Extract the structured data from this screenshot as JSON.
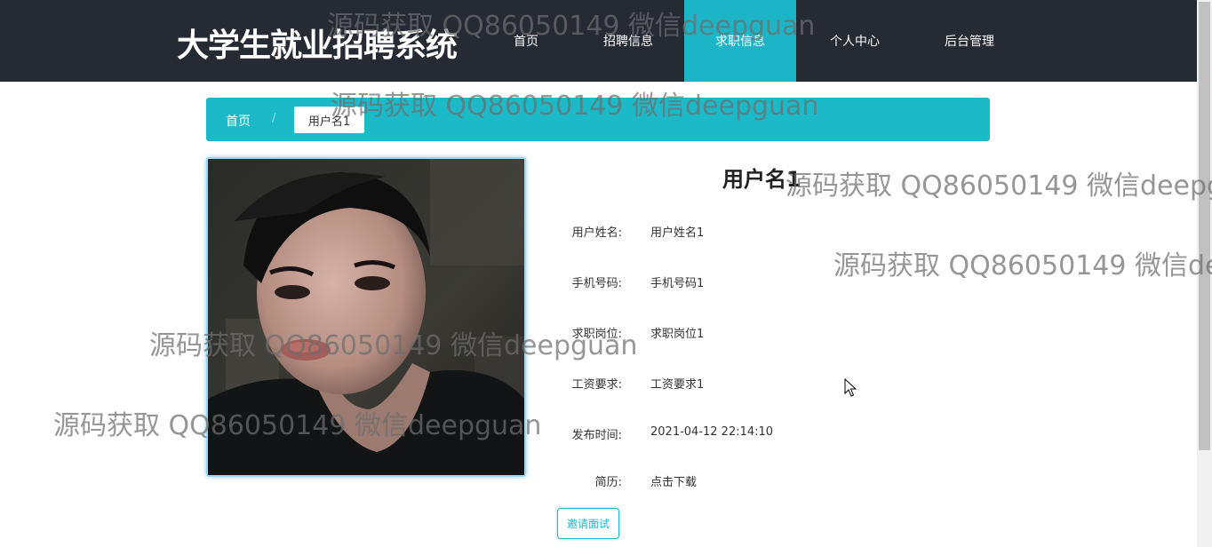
{
  "header": {
    "site_title": "大学生就业招聘系统",
    "nav": [
      "首页",
      "招聘信息",
      "求职信息",
      "个人中心",
      "后台管理"
    ],
    "active_nav": "求职信息"
  },
  "breadcrumb": {
    "home": "首页",
    "separator": "/",
    "current": "用户名1"
  },
  "detail": {
    "title": "用户名1",
    "fields": [
      {
        "label": "用户姓名:",
        "value": "用户姓名1"
      },
      {
        "label": "手机号码:",
        "value": "手机号码1"
      },
      {
        "label": "求职岗位:",
        "value": "求职岗位1"
      },
      {
        "label": "工资要求:",
        "value": "工资要求1"
      },
      {
        "label": "发布时间:",
        "value": "2021-04-12 22:14:10"
      },
      {
        "label": "简历:",
        "value": "点击下载"
      }
    ],
    "invite_button": "邀请面试"
  },
  "watermark": {
    "text": "源码获取 QQ86050149 微信deepguan",
    "text_cut_1": "源码获取 QQ86050149 微信deepg",
    "text_cut_2": "源码获取 QQ86050149 微信de"
  },
  "colors": {
    "header_bg": "#262a33",
    "accent": "#1cb9c9"
  }
}
